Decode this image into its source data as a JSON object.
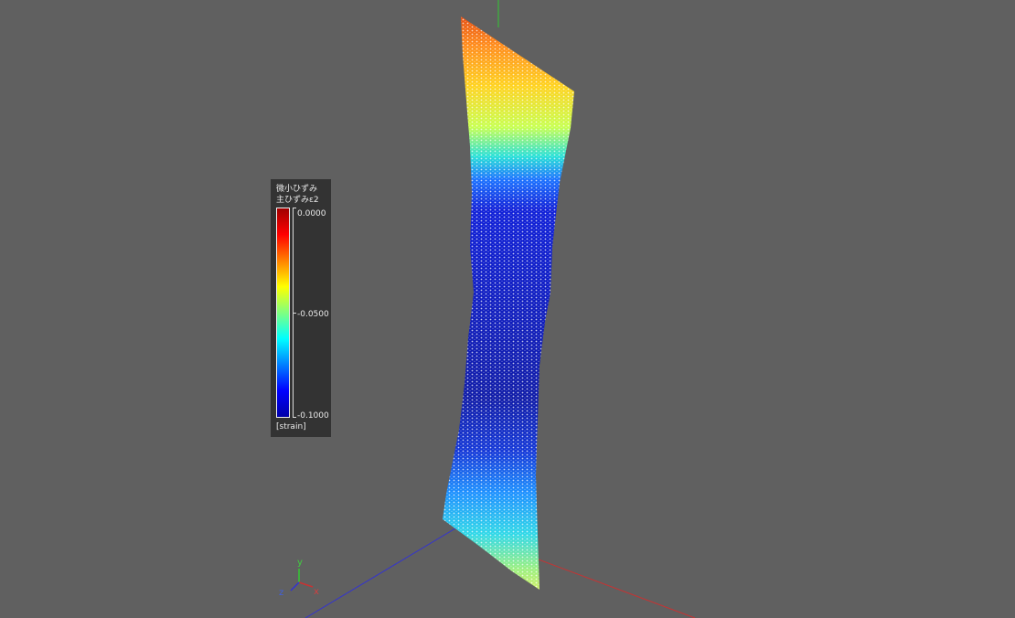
{
  "legend": {
    "title_line1": "微小ひずみ",
    "title_line2": "主ひずみε2",
    "ticks": [
      "0.0000",
      "-0.0500",
      "-0.1000"
    ],
    "unit": "[strain]",
    "colormap": [
      "#0000a8",
      "#0000ff",
      "#0080ff",
      "#00ffff",
      "#80ff80",
      "#ffff00",
      "#ff8000",
      "#ff0000",
      "#a00000"
    ]
  },
  "triad": {
    "x_label": "x",
    "y_label": "y",
    "z_label": "z"
  },
  "colors": {
    "background": "#606060",
    "axis_x": "#c83232",
    "axis_y": "#32c832",
    "axis_z": "#3232d2",
    "legend_bg": "#333333"
  }
}
